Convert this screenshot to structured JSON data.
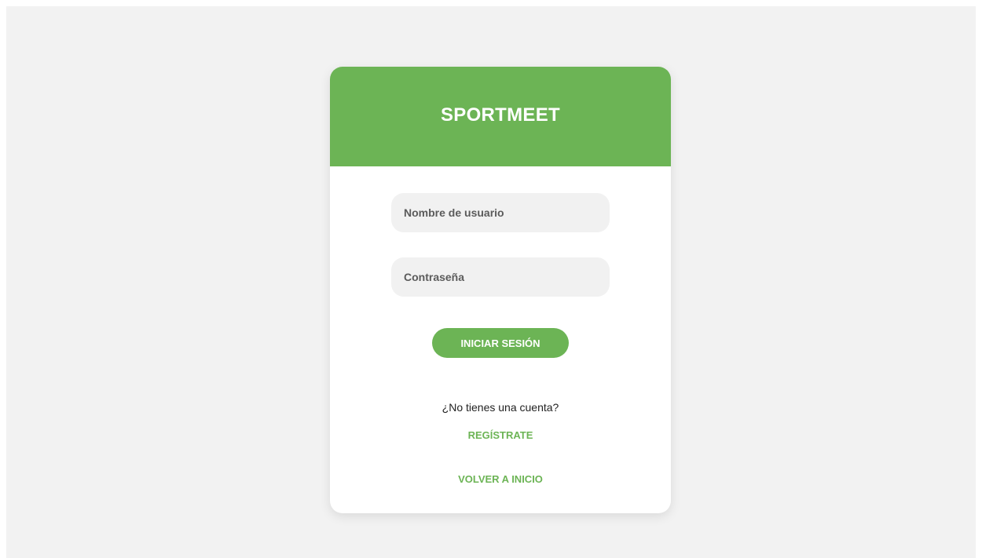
{
  "brand": {
    "title": "SPORTMEET"
  },
  "form": {
    "username_placeholder": "Nombre de usuario",
    "username_value": "",
    "password_placeholder": "Contraseña",
    "password_value": "",
    "submit_label": "INICIAR SESIÓN"
  },
  "footer": {
    "prompt_text": "¿No tienes una cuenta?",
    "register_label": "REGÍSTRATE",
    "home_label": "VOLVER A INICIO"
  },
  "colors": {
    "accent": "#6cb455",
    "page_background": "#f2f2f2",
    "field_background": "#f1f1f1",
    "card_background": "#ffffff"
  }
}
